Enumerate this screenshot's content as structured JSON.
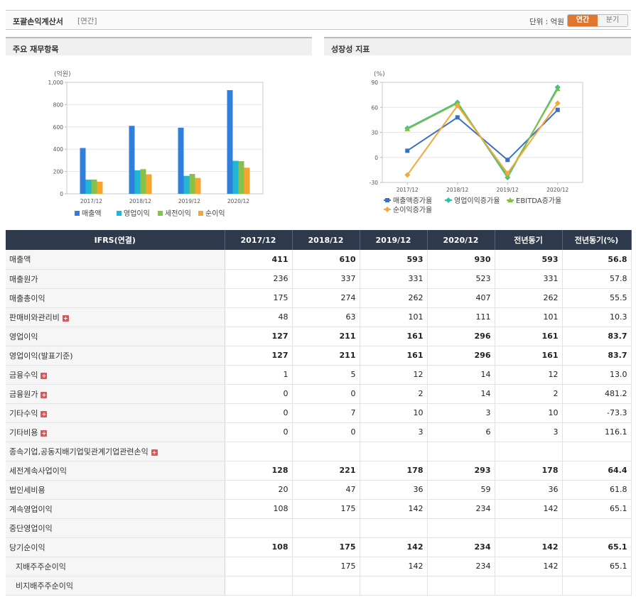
{
  "header": {
    "title": "포괄손익계산서",
    "subtitle": "[연간]",
    "unit_label": "단위 : 억원",
    "toggle_annual": "연간",
    "toggle_quarter": "분기"
  },
  "panel_left": {
    "title": "주요 재무항목"
  },
  "panel_right": {
    "title": "성장성 지표"
  },
  "chart_data": [
    {
      "type": "bar",
      "ylabel": "(억원)",
      "categories": [
        "2017/12",
        "2018/12",
        "2019/12",
        "2020/12"
      ],
      "ylim": [
        0,
        1000
      ],
      "yticks": [
        "0",
        "200",
        "400",
        "600",
        "800",
        "1,000"
      ],
      "series": [
        {
          "name": "매출액",
          "color": "#2f7fdc",
          "values": [
            411,
            610,
            593,
            930
          ]
        },
        {
          "name": "영업이익",
          "color": "#21b5d6",
          "values": [
            127,
            211,
            161,
            296
          ]
        },
        {
          "name": "세전이익",
          "color": "#86c14a",
          "values": [
            128,
            221,
            178,
            293
          ]
        },
        {
          "name": "순이익",
          "color": "#f7a52d",
          "values": [
            108,
            175,
            142,
            234
          ]
        }
      ],
      "legend_position": "bottom",
      "grid": true
    },
    {
      "type": "line",
      "ylabel": "(%)",
      "categories": [
        "2017/12",
        "2018/12",
        "2019/12",
        "2020/12"
      ],
      "ylim": [
        -30,
        90
      ],
      "yticks": [
        "-30",
        "0",
        "30",
        "60",
        "90"
      ],
      "series": [
        {
          "name": "매출액증가율",
          "color": "#3a6fc4",
          "marker": "square",
          "values": [
            8,
            48,
            -3,
            57
          ]
        },
        {
          "name": "영업이익증가율",
          "color": "#2bbfb0",
          "marker": "diamond",
          "values": [
            35,
            66,
            -24,
            84
          ]
        },
        {
          "name": "EBITDA증가율",
          "color": "#7fbf3f",
          "marker": "triangle",
          "values": [
            34,
            65,
            -22,
            82
          ]
        },
        {
          "name": "순이익증가율",
          "color": "#f5a83c",
          "marker": "diamond",
          "values": [
            -21,
            62,
            -19,
            65
          ]
        }
      ],
      "legend_position": "bottom",
      "grid": true
    }
  ],
  "table": {
    "headers": [
      "IFRS(연결)",
      "2017/12",
      "2018/12",
      "2019/12",
      "2020/12",
      "전년동기",
      "전년동기(%)"
    ],
    "rows": [
      {
        "label": "매출액",
        "values": [
          "411",
          "610",
          "593",
          "930",
          "593",
          "56.8"
        ]
      },
      {
        "label": "매출원가",
        "values": [
          "236",
          "337",
          "331",
          "523",
          "331",
          "57.8"
        ]
      },
      {
        "label": "매출총이익",
        "values": [
          "175",
          "274",
          "262",
          "407",
          "262",
          "55.5"
        ]
      },
      {
        "label": "판매비와관리비",
        "values": [
          "48",
          "63",
          "101",
          "111",
          "101",
          "10.3"
        ]
      },
      {
        "label": "영업이익",
        "values": [
          "127",
          "211",
          "161",
          "296",
          "161",
          "83.7"
        ]
      },
      {
        "label": "영업이익(발표기준)",
        "values": [
          "127",
          "211",
          "161",
          "296",
          "161",
          "83.7"
        ]
      },
      {
        "label": "금융수익",
        "values": [
          "1",
          "5",
          "12",
          "14",
          "12",
          "13.0"
        ]
      },
      {
        "label": "금융원가",
        "values": [
          "0",
          "0",
          "2",
          "14",
          "2",
          "481.2"
        ]
      },
      {
        "label": "기타수익",
        "values": [
          "0",
          "7",
          "10",
          "3",
          "10",
          "-73.3"
        ]
      },
      {
        "label": "기타비용",
        "values": [
          "0",
          "0",
          "3",
          "6",
          "3",
          "116.1"
        ]
      },
      {
        "label": "종속기업,공동지배기업및관계기업관련손익",
        "values": [
          "",
          "",
          "",
          "",
          "",
          ""
        ]
      },
      {
        "label": "세전계속사업이익",
        "values": [
          "128",
          "221",
          "178",
          "293",
          "178",
          "64.4"
        ]
      },
      {
        "label": "법인세비용",
        "values": [
          "20",
          "47",
          "36",
          "59",
          "36",
          "61.8"
        ]
      },
      {
        "label": "계속영업이익",
        "values": [
          "108",
          "175",
          "142",
          "234",
          "142",
          "65.1"
        ]
      },
      {
        "label": "중단영업이익",
        "values": [
          "",
          "",
          "",
          "",
          "",
          ""
        ]
      },
      {
        "label": "당기순이익",
        "values": [
          "108",
          "175",
          "142",
          "234",
          "142",
          "65.1"
        ]
      },
      {
        "label": "지배주주순이익",
        "values": [
          "",
          "175",
          "142",
          "234",
          "142",
          "65.1"
        ]
      },
      {
        "label": "비지배주주순이익",
        "values": [
          "",
          "",
          "",
          "",
          "",
          ""
        ]
      }
    ],
    "expand_symbol": "+"
  }
}
